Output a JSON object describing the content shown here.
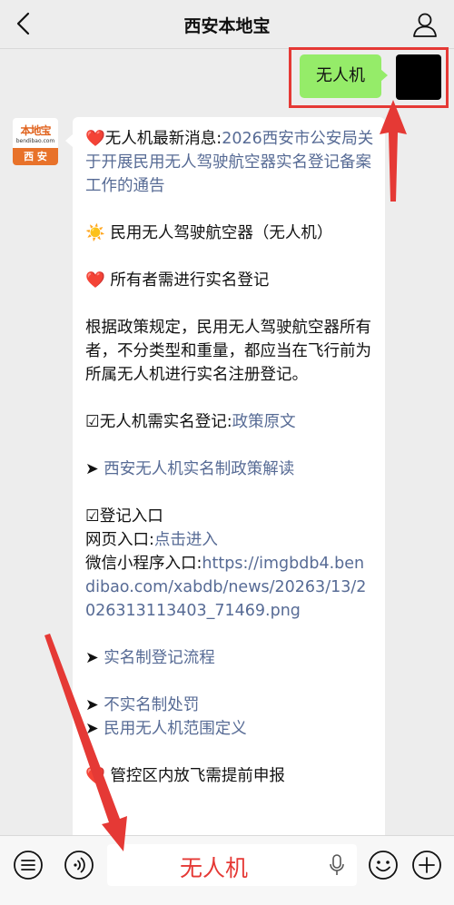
{
  "header": {
    "title": "西安本地宝"
  },
  "user_message": {
    "text": "无人机"
  },
  "bot": {
    "avatar": {
      "logo_text": "本地宝",
      "logo_url": "bendibao.com",
      "band_text": "西 安"
    },
    "message": {
      "line1_prefix": "无人机最新消息:",
      "line1_link": "2026西安市公安局关于开展民用无人驾驶航空器实名登记备案工作的通告",
      "line2": "民用无人驾驶航空器（无人机）",
      "line3": "所有者需进行实名登记",
      "para": "根据政策规定，民用无人驾驶航空器所有者，不分类型和重量，都应当在飞行前为所属无人机进行实名注册登记。",
      "policy_prefix": "☑无人机需实名登记:",
      "policy_link": "政策原文",
      "interpret_prefix": "➤ ",
      "interpret_link": "西安无人机实名制政策解读",
      "entry_title": "☑登记入口",
      "web_prefix": "网页入口:",
      "web_link": "点击进入",
      "mini_prefix": "微信小程序入口:",
      "mini_link": "https://imgbdb4.bendibao.com/xabdb/news/20263/13/2026313113403_71469.png",
      "flow_prefix": "➤ ",
      "flow_link": "实名制登记流程",
      "penalty_prefix": "➤ ",
      "penalty_link": "不实名制处罚",
      "scope_prefix": "➤ ",
      "scope_link": "民用无人机范围定义",
      "control_text": "管控区内放飞需提前申报"
    }
  },
  "input_bar": {
    "text": "无人机"
  },
  "colors": {
    "highlight": "#e53935",
    "link": "#576b95",
    "user_bubble": "#95ec69"
  }
}
